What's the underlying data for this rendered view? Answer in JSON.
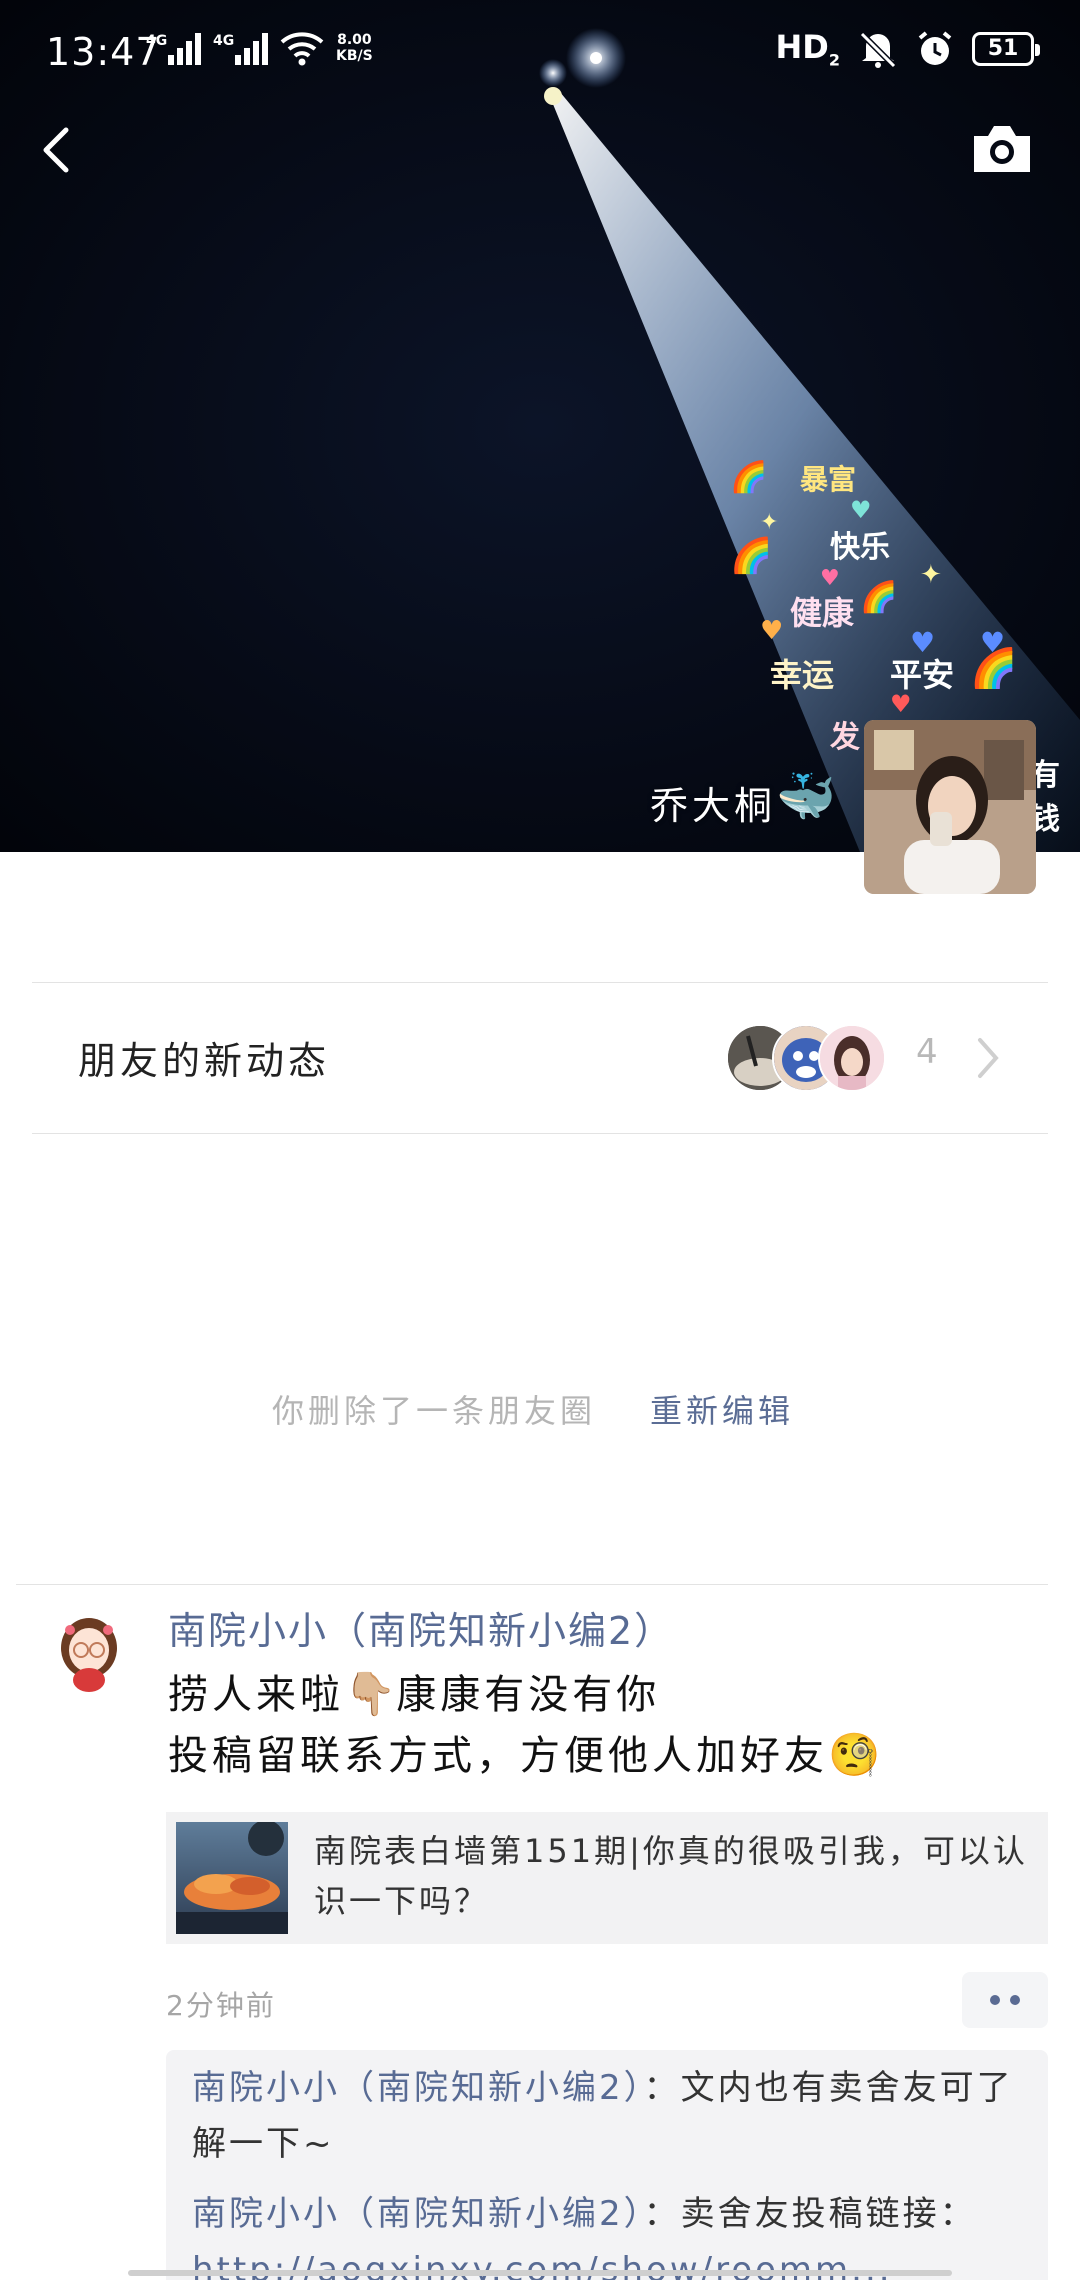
{
  "status_bar": {
    "time": "13:47",
    "signal_label_1": "4G",
    "signal_label_2": "4G",
    "net_speed_value": "8.00",
    "net_speed_unit": "KB/S",
    "hd_label": "HD",
    "hd_sub": "2",
    "battery": "51",
    "icons": [
      "signal-icon",
      "signal-icon",
      "wifi-icon",
      "hd-icon",
      "mute-icon",
      "alarm-icon",
      "battery-icon"
    ]
  },
  "header": {
    "back_icon": "chevron-left-icon",
    "camera_icon": "camera-icon"
  },
  "cover": {
    "owner_name": "乔大桐",
    "owner_emoji": "🐳",
    "sticker_words": [
      "暴富",
      "快乐",
      "健康",
      "幸运",
      "平安",
      "有钱",
      "发"
    ]
  },
  "friends_updates": {
    "label": "朋友的新动态",
    "count": "4"
  },
  "deleted_notice": {
    "text": "你删除了一条朋友圈",
    "action": "重新编辑"
  },
  "post": {
    "author": "南院小小（南院知新小编2）",
    "line1_a": "捞人来啦",
    "line1_emoji": "👇🏼",
    "line1_b": "康康有没有你",
    "line2": "投稿留联系方式，方便他人加好友",
    "line2_emoji": "🧐",
    "link_title": "南院表白墙第151期|你真的很吸引我，可以认识一下吗？",
    "time": "2分钟前",
    "comments": [
      {
        "author": "南院小小（南院知新小编2）",
        "text": "：文内也有卖舍友可了解一下~"
      },
      {
        "author": "南院小小（南院知新小编2）",
        "text": "：卖舍友投稿链接：",
        "link": "http://aoqxinxy.com/show/roomm..."
      }
    ]
  },
  "colors": {
    "link_blue": "#586b94",
    "cover_bg": "#050914",
    "muted_text": "#b5b5b5"
  }
}
